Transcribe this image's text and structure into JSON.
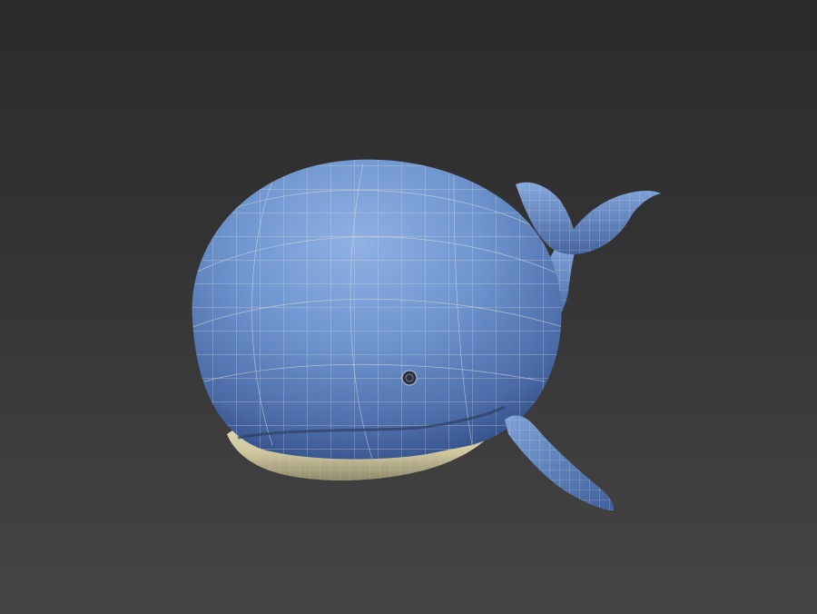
{
  "viewport": {
    "background_top": "#2b2b2b",
    "background_bottom": "#454545"
  },
  "model": {
    "subject": "whale",
    "render_style": "smooth shaded with wireframe overlay",
    "body_color": "#6f95cf",
    "body_shadow_color": "#3c5a92",
    "belly_color": "#d8d0a8",
    "wire_color": "#c9c9c9",
    "eye_color": "#2a2f3a"
  }
}
